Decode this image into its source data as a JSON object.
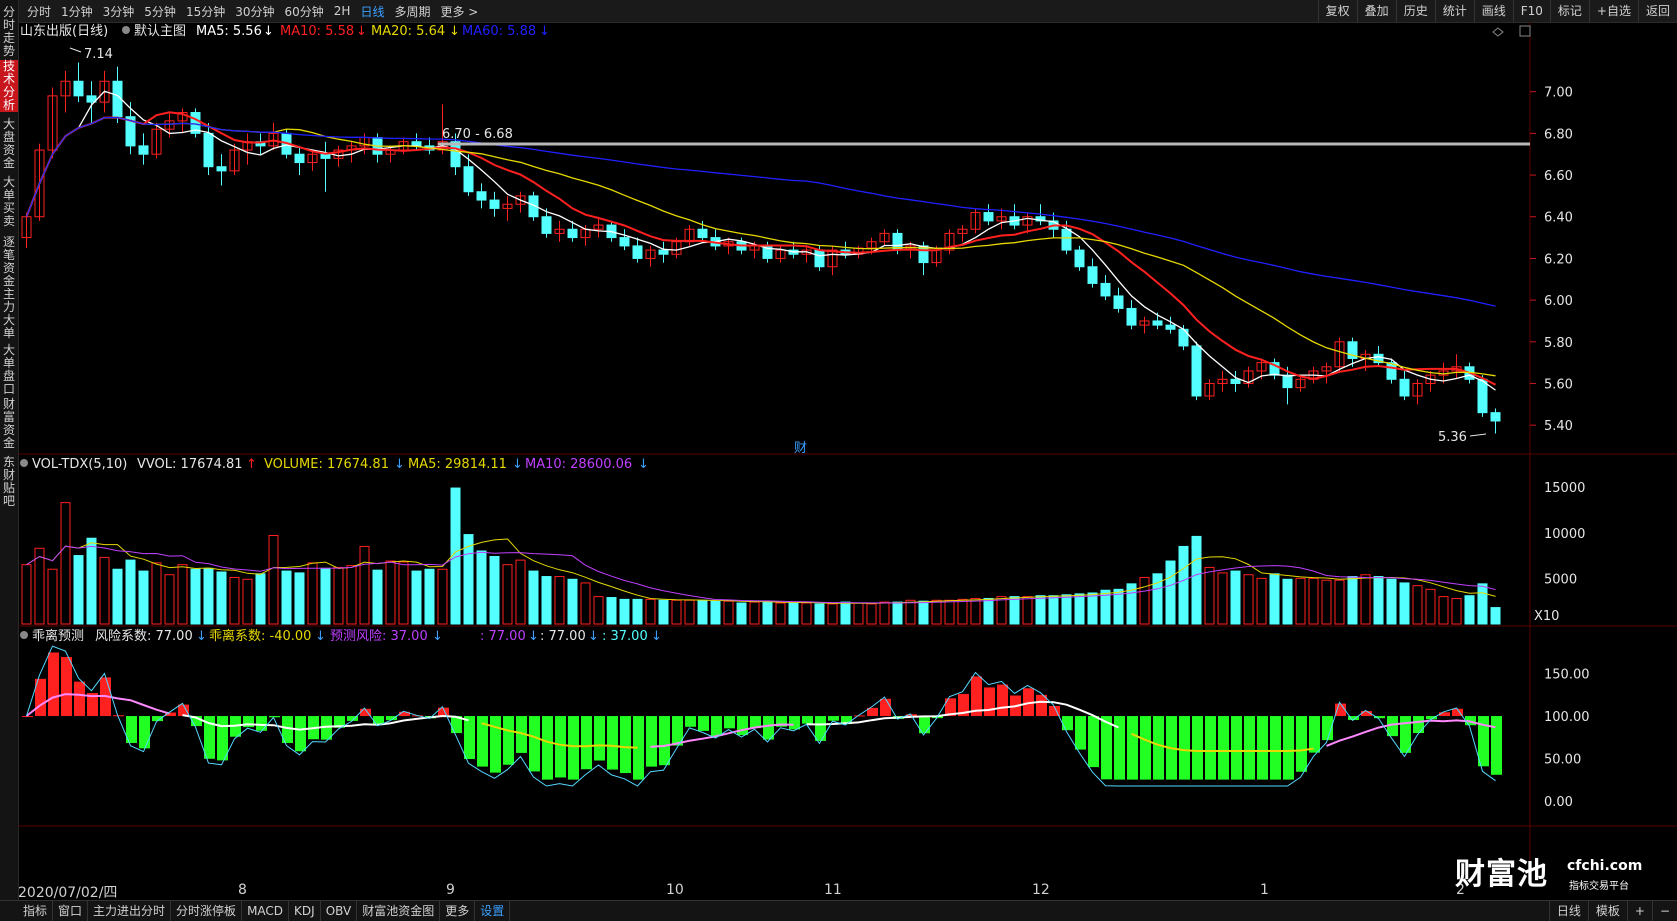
{
  "toolbar": {
    "periods": [
      "分时",
      "1分钟",
      "3分钟",
      "5分钟",
      "15分钟",
      "30分钟",
      "60分钟",
      "2H",
      "日线",
      "多周期",
      "更多 >"
    ],
    "active_period": "日线",
    "tools": [
      "复权",
      "叠加",
      "历史",
      "统计",
      "画线",
      "F10",
      "标记",
      "+自选",
      "返回"
    ]
  },
  "sidebar": {
    "items": [
      "分时走势",
      "技术分析",
      "大盘资金",
      "大单买卖",
      "逐笔资金",
      "主力大单",
      "大单盘口",
      "财富资金",
      "东财贴吧"
    ],
    "active": "技术分析"
  },
  "main_legend": {
    "stock": "山东出版(日线)",
    "template": "默认主图",
    "ma5": "MA5: 5.56",
    "ma10": "MA10: 5.58",
    "ma20": "MA20: 5.64",
    "ma60": "MA60: 5.88",
    "ma5_arrow": "↓",
    "ma10_arrow": "↓",
    "ma20_arrow": "↓",
    "ma60_arrow": "↓"
  },
  "annotations": {
    "high_label": "7.14",
    "low_label": "5.36",
    "range_label": "6.70 - 6.68",
    "event_label": "财"
  },
  "vol_legend": {
    "name": "VOL-TDX(5,10)",
    "vvol": "VVOL: 17674.81",
    "vvol_arrow": "↑",
    "volume": "VOLUME: 17674.81",
    "volume_arrow": "↓",
    "ma5": "MA5: 29814.11",
    "ma5_arrow": "↓",
    "ma10": "MA10: 28600.06",
    "ma10_arrow": "↓"
  },
  "ind_legend": {
    "name": "乖离预测",
    "risk": "风险系数: 77.00",
    "risk_arrow": "↓",
    "deviation": "乖离系数: -40.00",
    "deviation_arrow": "↓",
    "forecast": "预测风险: 37.00",
    "forecast_arrow": "↓",
    "v1": ": 77.00",
    "v1_arrow": "↓",
    "v2": ": 77.00",
    "v2_arrow": "↓",
    "v3": ": 37.00",
    "v3_arrow": "↓"
  },
  "axes": {
    "price_ticks": [
      "7.00",
      "6.80",
      "6.60",
      "6.40",
      "6.20",
      "6.00",
      "5.80",
      "5.60",
      "5.40"
    ],
    "volume_ticks": [
      "15000",
      "10000",
      "5000"
    ],
    "volume_unit": "X10",
    "indicator_ticks": [
      "150.00",
      "100.00",
      "50.00",
      "0.00"
    ],
    "dates": [
      "2020/07/02/四",
      "8",
      "9",
      "10",
      "11",
      "12",
      "1",
      "2"
    ]
  },
  "bottom_tabs": [
    "指标",
    "窗口",
    "主力进出分时",
    "分时涨停板",
    "MACD",
    "KDJ",
    "OBV",
    "财富池资金图",
    "更多",
    "设置"
  ],
  "bottom_active": "设置",
  "bottom_right": [
    "模板",
    "+",
    "−"
  ],
  "bottom_period": "日线",
  "watermark": {
    "main": "财富池",
    "domain": "cfchi.com",
    "sub": "指标交易平台"
  },
  "colors": {
    "up": "#ff2020",
    "down": "#54ffff",
    "ma5": "#ffffff",
    "ma10": "#ff2020",
    "ma20": "#e6d800",
    "ma60": "#2020ff",
    "vol_ma5": "#e6d800",
    "vol_ma10": "#c040ff"
  },
  "chart_data": {
    "type": "candlestick",
    "price_range": [
      5.3,
      7.2
    ],
    "candles": [
      [
        6.3,
        6.42,
        6.25,
        6.4
      ],
      [
        6.4,
        6.75,
        6.38,
        6.72
      ],
      [
        6.72,
        7.02,
        6.68,
        6.98
      ],
      [
        6.98,
        7.1,
        6.9,
        7.05
      ],
      [
        7.05,
        7.14,
        6.95,
        6.98
      ],
      [
        6.98,
        7.05,
        6.85,
        6.95
      ],
      [
        6.95,
        7.1,
        6.9,
        7.05
      ],
      [
        7.05,
        7.12,
        6.85,
        6.88
      ],
      [
        6.88,
        6.95,
        6.7,
        6.74
      ],
      [
        6.74,
        6.8,
        6.65,
        6.7
      ],
      [
        6.7,
        6.85,
        6.68,
        6.82
      ],
      [
        6.82,
        6.9,
        6.78,
        6.86
      ],
      [
        6.86,
        6.92,
        6.8,
        6.9
      ],
      [
        6.9,
        6.92,
        6.78,
        6.8
      ],
      [
        6.8,
        6.85,
        6.6,
        6.64
      ],
      [
        6.64,
        6.7,
        6.55,
        6.62
      ],
      [
        6.62,
        6.75,
        6.6,
        6.72
      ],
      [
        6.72,
        6.8,
        6.65,
        6.76
      ],
      [
        6.76,
        6.8,
        6.7,
        6.74
      ],
      [
        6.74,
        6.85,
        6.72,
        6.8
      ],
      [
        6.8,
        6.82,
        6.68,
        6.7
      ],
      [
        6.7,
        6.74,
        6.6,
        6.66
      ],
      [
        6.66,
        6.72,
        6.62,
        6.7
      ],
      [
        6.7,
        6.76,
        6.52,
        6.68
      ],
      [
        6.68,
        6.74,
        6.64,
        6.72
      ],
      [
        6.72,
        6.76,
        6.66,
        6.74
      ],
      [
        6.74,
        6.8,
        6.7,
        6.78
      ],
      [
        6.78,
        6.8,
        6.66,
        6.7
      ],
      [
        6.7,
        6.74,
        6.66,
        6.72
      ],
      [
        6.72,
        6.78,
        6.7,
        6.76
      ],
      [
        6.76,
        6.8,
        6.72,
        6.74
      ],
      [
        6.74,
        6.78,
        6.7,
        6.72
      ],
      [
        6.72,
        6.94,
        6.7,
        6.76
      ],
      [
        6.76,
        6.8,
        6.6,
        6.64
      ],
      [
        6.64,
        6.7,
        6.5,
        6.52
      ],
      [
        6.52,
        6.56,
        6.44,
        6.48
      ],
      [
        6.48,
        6.52,
        6.4,
        6.44
      ],
      [
        6.44,
        6.5,
        6.38,
        6.46
      ],
      [
        6.46,
        6.52,
        6.42,
        6.5
      ],
      [
        6.5,
        6.52,
        6.38,
        6.4
      ],
      [
        6.4,
        6.44,
        6.3,
        6.32
      ],
      [
        6.32,
        6.38,
        6.28,
        6.34
      ],
      [
        6.34,
        6.38,
        6.28,
        6.3
      ],
      [
        6.3,
        6.36,
        6.26,
        6.34
      ],
      [
        6.34,
        6.4,
        6.3,
        6.36
      ],
      [
        6.36,
        6.38,
        6.28,
        6.3
      ],
      [
        6.3,
        6.34,
        6.24,
        6.26
      ],
      [
        6.26,
        6.3,
        6.18,
        6.2
      ],
      [
        6.2,
        6.26,
        6.16,
        6.24
      ],
      [
        6.24,
        6.28,
        6.18,
        6.22
      ],
      [
        6.22,
        6.3,
        6.2,
        6.28
      ],
      [
        6.28,
        6.36,
        6.26,
        6.34
      ],
      [
        6.34,
        6.38,
        6.28,
        6.3
      ],
      [
        6.3,
        6.34,
        6.24,
        6.26
      ],
      [
        6.26,
        6.3,
        6.22,
        6.28
      ],
      [
        6.28,
        6.3,
        6.22,
        6.24
      ],
      [
        6.24,
        6.28,
        6.2,
        6.26
      ],
      [
        6.26,
        6.28,
        6.18,
        6.2
      ],
      [
        6.2,
        6.26,
        6.18,
        6.24
      ],
      [
        6.24,
        6.28,
        6.2,
        6.22
      ],
      [
        6.22,
        6.26,
        6.18,
        6.24
      ],
      [
        6.24,
        6.26,
        6.14,
        6.16
      ],
      [
        6.16,
        6.26,
        6.12,
        6.24
      ],
      [
        6.24,
        6.28,
        6.2,
        6.22
      ],
      [
        6.22,
        6.26,
        6.2,
        6.25
      ],
      [
        6.25,
        6.3,
        6.22,
        6.28
      ],
      [
        6.28,
        6.34,
        6.26,
        6.32
      ],
      [
        6.32,
        6.34,
        6.22,
        6.24
      ],
      [
        6.24,
        6.28,
        6.2,
        6.26
      ],
      [
        6.26,
        6.28,
        6.12,
        6.18
      ],
      [
        6.18,
        6.26,
        6.16,
        6.24
      ],
      [
        6.24,
        6.34,
        6.22,
        6.32
      ],
      [
        6.32,
        6.36,
        6.28,
        6.34
      ],
      [
        6.34,
        6.44,
        6.32,
        6.42
      ],
      [
        6.42,
        6.46,
        6.36,
        6.38
      ],
      [
        6.38,
        6.44,
        6.34,
        6.4
      ],
      [
        6.4,
        6.46,
        6.34,
        6.36
      ],
      [
        6.36,
        6.42,
        6.32,
        6.4
      ],
      [
        6.4,
        6.46,
        6.36,
        6.38
      ],
      [
        6.38,
        6.42,
        6.3,
        6.34
      ],
      [
        6.34,
        6.38,
        6.22,
        6.24
      ],
      [
        6.24,
        6.26,
        6.14,
        6.16
      ],
      [
        6.16,
        6.2,
        6.06,
        6.08
      ],
      [
        6.08,
        6.12,
        6.0,
        6.02
      ],
      [
        6.02,
        6.06,
        5.94,
        5.96
      ],
      [
        5.96,
        6.0,
        5.86,
        5.88
      ],
      [
        5.88,
        5.92,
        5.84,
        5.9
      ],
      [
        5.9,
        5.94,
        5.86,
        5.88
      ],
      [
        5.88,
        5.92,
        5.84,
        5.86
      ],
      [
        5.86,
        5.88,
        5.76,
        5.78
      ],
      [
        5.78,
        5.8,
        5.52,
        5.54
      ],
      [
        5.54,
        5.62,
        5.52,
        5.6
      ],
      [
        5.6,
        5.66,
        5.56,
        5.62
      ],
      [
        5.62,
        5.66,
        5.56,
        5.6
      ],
      [
        5.6,
        5.68,
        5.58,
        5.66
      ],
      [
        5.66,
        5.72,
        5.62,
        5.7
      ],
      [
        5.7,
        5.72,
        5.62,
        5.64
      ],
      [
        5.64,
        5.68,
        5.5,
        5.58
      ],
      [
        5.58,
        5.64,
        5.56,
        5.62
      ],
      [
        5.62,
        5.68,
        5.6,
        5.66
      ],
      [
        5.66,
        5.7,
        5.6,
        5.68
      ],
      [
        5.68,
        5.82,
        5.66,
        5.8
      ],
      [
        5.8,
        5.82,
        5.68,
        5.72
      ],
      [
        5.72,
        5.76,
        5.66,
        5.74
      ],
      [
        5.74,
        5.78,
        5.68,
        5.7
      ],
      [
        5.7,
        5.72,
        5.6,
        5.62
      ],
      [
        5.62,
        5.66,
        5.52,
        5.54
      ],
      [
        5.54,
        5.62,
        5.5,
        5.6
      ],
      [
        5.6,
        5.66,
        5.56,
        5.64
      ],
      [
        5.64,
        5.7,
        5.6,
        5.66
      ],
      [
        5.66,
        5.74,
        5.62,
        5.68
      ],
      [
        5.68,
        5.7,
        5.6,
        5.62
      ],
      [
        5.62,
        5.64,
        5.44,
        5.46
      ],
      [
        5.46,
        5.48,
        5.36,
        5.42
      ]
    ],
    "volume": [
      6500,
      8300,
      6000,
      13300,
      7500,
      9400,
      7300,
      6000,
      7000,
      5800,
      6700,
      5400,
      6500,
      6000,
      6100,
      5700,
      5100,
      4900,
      5500,
      9700,
      5800,
      5600,
      6700,
      6100,
      6200,
      6400,
      8500,
      5900,
      6900,
      6800,
      5800,
      6000,
      6000,
      14900,
      9800,
      8000,
      7400,
      6500,
      7000,
      5800,
      5200,
      5200,
      4900,
      4500,
      3000,
      2900,
      2700,
      2700,
      2700,
      2600,
      2600,
      2600,
      2600,
      2500,
      2500,
      2300,
      2400,
      2500,
      2300,
      2300,
      2300,
      2200,
      2200,
      2400,
      2300,
      2200,
      2400,
      2400,
      2600,
      2500,
      2600,
      2600,
      2700,
      2800,
      2800,
      3000,
      3000,
      3000,
      3100,
      3100,
      3200,
      3300,
      3400,
      3700,
      3800,
      4400,
      5100,
      5500,
      6900,
      8500,
      9600,
      6200,
      5600,
      5800,
      5400,
      5000,
      5500,
      4900,
      5000,
      5000,
      4800,
      4800,
      5200,
      5400,
      5200,
      4900,
      4500,
      4200,
      3800,
      3000,
      2800,
      3100,
      4400,
      1800
    ],
    "volume_range": [
      0,
      16000
    ],
    "indicator_range": [
      -25,
      185
    ]
  }
}
